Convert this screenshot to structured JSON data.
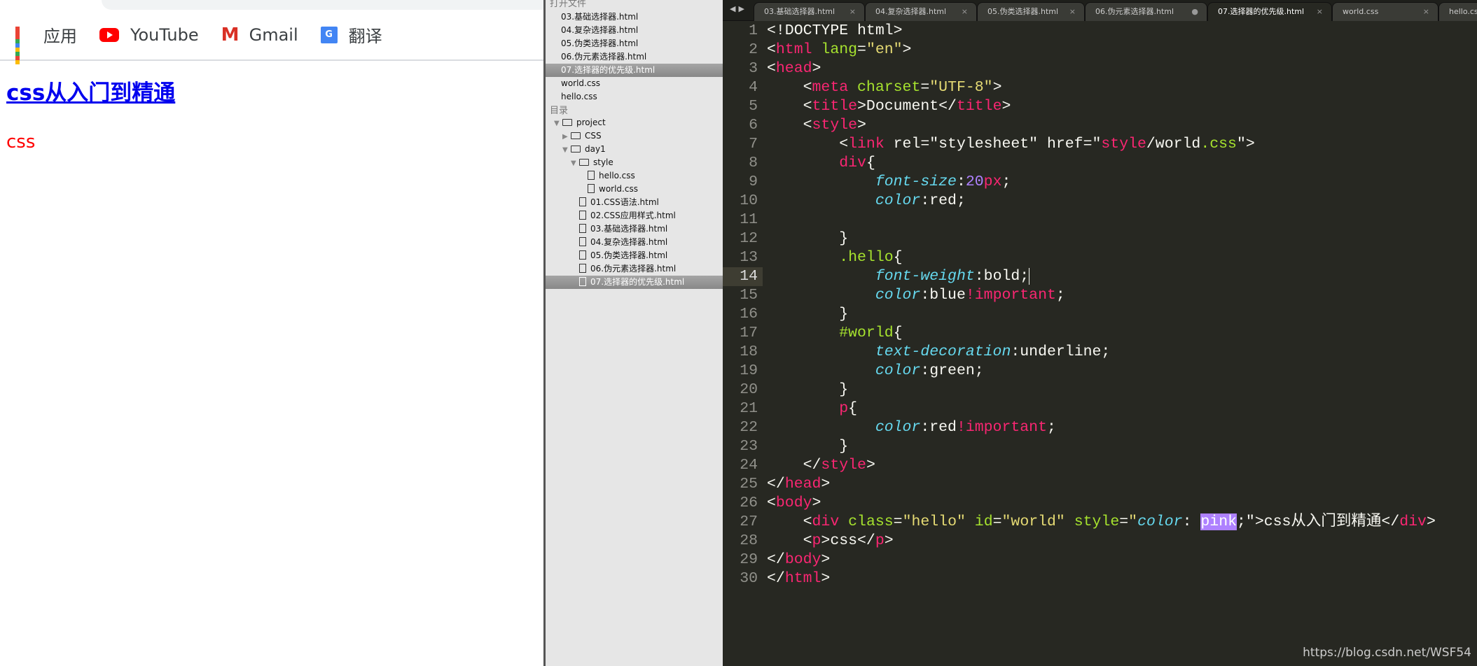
{
  "browser": {
    "bookmarks": [
      {
        "label": "应用",
        "icon": "apps-grid-icon"
      },
      {
        "label": "YouTube",
        "icon": "youtube-icon"
      },
      {
        "label": "Gmail",
        "icon": "gmail-icon"
      },
      {
        "label": "翻译",
        "icon": "google-translate-icon"
      }
    ],
    "heading": "css从入门到精通",
    "paragraph": "css",
    "colors": {
      "link": "#0000ee",
      "paragraph": "#ff0000"
    }
  },
  "sidebar": {
    "open_files_header": "打开文件",
    "open_files": [
      "03.基础选择器.html",
      "04.复杂选择器.html",
      "05.伪类选择器.html",
      "06.伪元素选择器.html",
      "07.选择器的优先级.html",
      "world.css",
      "hello.css"
    ],
    "active_open_file": "07.选择器的优先级.html",
    "folders_header": "目录",
    "tree": [
      {
        "label": "project",
        "type": "folder",
        "open": true,
        "depth": 0
      },
      {
        "label": "CSS",
        "type": "folder",
        "open": false,
        "depth": 1
      },
      {
        "label": "day1",
        "type": "folder",
        "open": true,
        "depth": 1
      },
      {
        "label": "style",
        "type": "folder",
        "open": true,
        "depth": 2
      },
      {
        "label": "hello.css",
        "type": "file",
        "depth": 3
      },
      {
        "label": "world.css",
        "type": "file",
        "depth": 3
      },
      {
        "label": "01.CSS语法.html",
        "type": "file",
        "depth": 2
      },
      {
        "label": "02.CSS应用样式.html",
        "type": "file",
        "depth": 2
      },
      {
        "label": "03.基础选择器.html",
        "type": "file",
        "depth": 2
      },
      {
        "label": "04.复杂选择器.html",
        "type": "file",
        "depth": 2
      },
      {
        "label": "05.伪类选择器.html",
        "type": "file",
        "depth": 2
      },
      {
        "label": "06.伪元素选择器.html",
        "type": "file",
        "depth": 2
      },
      {
        "label": "07.选择器的优先级.html",
        "type": "file",
        "depth": 2,
        "active": true
      }
    ]
  },
  "editor": {
    "tabs": [
      {
        "label": "03.基础选择器.html",
        "close": "×"
      },
      {
        "label": "04.复杂选择器.html",
        "close": "×"
      },
      {
        "label": "05.伪类选择器.html",
        "close": "×"
      },
      {
        "label": "06.伪元素选择器.html",
        "close": "●"
      },
      {
        "label": "07.选择器的优先级.html",
        "close": "×",
        "active": true
      },
      {
        "label": "world.css",
        "close": "×"
      },
      {
        "label": "hello.css",
        "close": ""
      }
    ],
    "current_line": 14,
    "lines": [
      [
        [
          "w",
          "<!DOCTYPE html>"
        ]
      ],
      [
        [
          "w",
          "<"
        ],
        [
          "t",
          "html"
        ],
        [
          "w",
          " "
        ],
        [
          "a",
          "lang"
        ],
        [
          "w",
          "="
        ],
        [
          "s",
          "\"en\""
        ],
        [
          "w",
          ">"
        ]
      ],
      [
        [
          "w",
          "<"
        ],
        [
          "t",
          "head"
        ],
        [
          "w",
          ">"
        ]
      ],
      [
        [
          "w",
          "    <"
        ],
        [
          "t",
          "meta"
        ],
        [
          "w",
          " "
        ],
        [
          "a",
          "charset"
        ],
        [
          "w",
          "="
        ],
        [
          "s",
          "\"UTF-8\""
        ],
        [
          "w",
          ">"
        ]
      ],
      [
        [
          "w",
          "    <"
        ],
        [
          "t",
          "title"
        ],
        [
          "w",
          ">Document</"
        ],
        [
          "t",
          "title"
        ],
        [
          "w",
          ">"
        ]
      ],
      [
        [
          "w",
          "    <"
        ],
        [
          "t",
          "style"
        ],
        [
          "w",
          ">"
        ]
      ],
      [
        [
          "w",
          "        <"
        ],
        [
          "t",
          "link"
        ],
        [
          "w",
          " rel=\"stylesheet\" href=\""
        ],
        [
          "t",
          "style"
        ],
        [
          "w",
          "/world"
        ],
        [
          "a",
          ".css"
        ],
        [
          "w",
          "\">"
        ]
      ],
      [
        [
          "w",
          "        "
        ],
        [
          "t",
          "div"
        ],
        [
          "w",
          "{"
        ]
      ],
      [
        [
          "w",
          "            "
        ],
        [
          "p",
          "font-size"
        ],
        [
          "w",
          ":"
        ],
        [
          "n",
          "20"
        ],
        [
          "t",
          "px"
        ],
        [
          "w",
          ";"
        ]
      ],
      [
        [
          "w",
          "            "
        ],
        [
          "p",
          "color"
        ],
        [
          "w",
          ":red;"
        ]
      ],
      [
        [
          "w",
          ""
        ]
      ],
      [
        [
          "w",
          "        }"
        ]
      ],
      [
        [
          "w",
          "        "
        ],
        [
          "a",
          ".hello"
        ],
        [
          "w",
          "{"
        ]
      ],
      [
        [
          "w",
          "            "
        ],
        [
          "p",
          "font-weight"
        ],
        [
          "w",
          ":bold;"
        ],
        [
          "caret",
          ""
        ]
      ],
      [
        [
          "w",
          "            "
        ],
        [
          "p",
          "color"
        ],
        [
          "w",
          ":blue"
        ],
        [
          "t",
          "!important"
        ],
        [
          "w",
          ";"
        ]
      ],
      [
        [
          "w",
          "        }"
        ]
      ],
      [
        [
          "w",
          "        "
        ],
        [
          "a",
          "#world"
        ],
        [
          "w",
          "{"
        ]
      ],
      [
        [
          "w",
          "            "
        ],
        [
          "p",
          "text-decoration"
        ],
        [
          "w",
          ":underline;"
        ]
      ],
      [
        [
          "w",
          "            "
        ],
        [
          "p",
          "color"
        ],
        [
          "w",
          ":green;"
        ]
      ],
      [
        [
          "w",
          "        }"
        ]
      ],
      [
        [
          "w",
          "        "
        ],
        [
          "t",
          "p"
        ],
        [
          "w",
          "{"
        ]
      ],
      [
        [
          "w",
          "            "
        ],
        [
          "p",
          "color"
        ],
        [
          "w",
          ":red"
        ],
        [
          "t",
          "!important"
        ],
        [
          "w",
          ";"
        ]
      ],
      [
        [
          "w",
          "        }"
        ]
      ],
      [
        [
          "w",
          "    </"
        ],
        [
          "t",
          "style"
        ],
        [
          "w",
          ">"
        ]
      ],
      [
        [
          "w",
          "</"
        ],
        [
          "t",
          "head"
        ],
        [
          "w",
          ">"
        ]
      ],
      [
        [
          "w",
          "<"
        ],
        [
          "t",
          "body"
        ],
        [
          "w",
          ">"
        ]
      ],
      [
        [
          "w",
          "    <"
        ],
        [
          "t",
          "div"
        ],
        [
          "w",
          " "
        ],
        [
          "a",
          "class"
        ],
        [
          "w",
          "="
        ],
        [
          "s",
          "\"hello\""
        ],
        [
          "w",
          " "
        ],
        [
          "a",
          "id"
        ],
        [
          "w",
          "="
        ],
        [
          "s",
          "\"world\""
        ],
        [
          "w",
          " "
        ],
        [
          "a",
          "style"
        ],
        [
          "w",
          "="
        ],
        [
          "s",
          "\""
        ],
        [
          "p",
          "color"
        ],
        [
          "w",
          ": "
        ],
        [
          "sel",
          "pink"
        ],
        [
          "w",
          ";\">css从入门到精通</"
        ],
        [
          "t",
          "div"
        ],
        [
          "w",
          ">"
        ]
      ],
      [
        [
          "w",
          "    <"
        ],
        [
          "t",
          "p"
        ],
        [
          "w",
          ">css</"
        ],
        [
          "t",
          "p"
        ],
        [
          "w",
          ">"
        ]
      ],
      [
        [
          "w",
          "</"
        ],
        [
          "t",
          "body"
        ],
        [
          "w",
          ">"
        ]
      ],
      [
        [
          "w",
          "</"
        ],
        [
          "t",
          "html"
        ],
        [
          "w",
          ">"
        ]
      ]
    ],
    "colors": {
      "background": "#272822",
      "tag": "#f92672",
      "attribute": "#a6e22e",
      "string": "#e6db74",
      "property": "#66d9ef",
      "number": "#ae81ff"
    }
  },
  "watermark": "https://blog.csdn.net/WSF54"
}
